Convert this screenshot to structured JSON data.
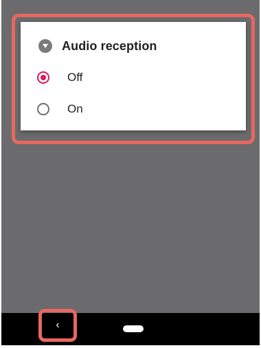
{
  "dialog": {
    "title": "Audio reception",
    "icon": "collapse-arrow-icon",
    "options": [
      {
        "label": "Off",
        "selected": true
      },
      {
        "label": "On",
        "selected": false
      }
    ],
    "accent_color": "#d81b60"
  },
  "navbar": {
    "back_symbol": "‹",
    "back_icon": "back-icon",
    "home_icon": "home-pill-icon"
  },
  "highlight_color": "#e8675f"
}
